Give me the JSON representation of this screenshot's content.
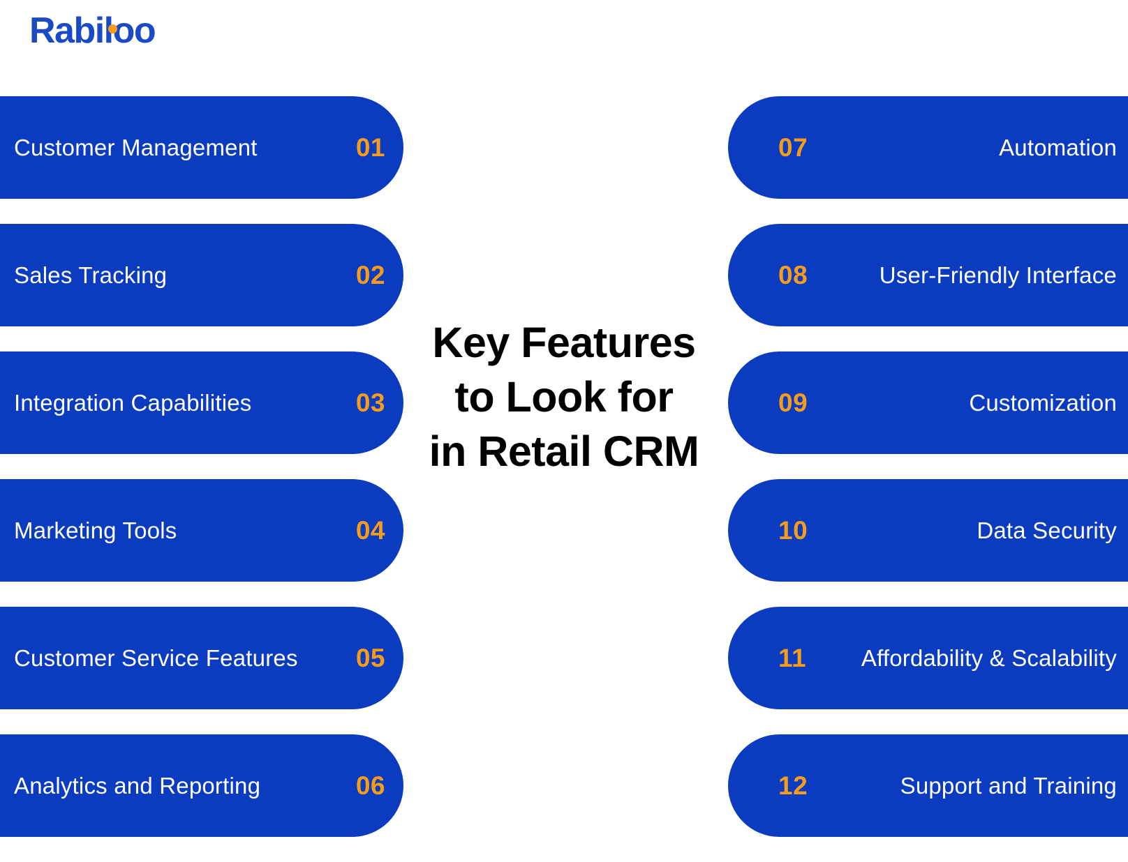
{
  "brand": {
    "name": "Rabiloo",
    "blue": "#1b4ac6",
    "orange": "#f59c1c"
  },
  "colors": {
    "pill_blue": "#0b3cc0",
    "number_orange": "#f59c1c",
    "label_white": "#ffffff",
    "title_black": "#000000",
    "background": "#ffffff"
  },
  "title": {
    "line1": "Key Features",
    "line2": "to Look for",
    "line3": "in Retail CRM",
    "full": "Key Features to Look for in Retail CRM"
  },
  "left_column": [
    {
      "number": "01",
      "label": "Customer Management"
    },
    {
      "number": "02",
      "label": "Sales Tracking"
    },
    {
      "number": "03",
      "label": "Integration Capabilities"
    },
    {
      "number": "04",
      "label": "Marketing Tools"
    },
    {
      "number": "05",
      "label": "Customer Service Features"
    },
    {
      "number": "06",
      "label": "Analytics and Reporting"
    }
  ],
  "right_column": [
    {
      "number": "07",
      "label": "Automation"
    },
    {
      "number": "08",
      "label": "User-Friendly Interface"
    },
    {
      "number": "09",
      "label": "Customization"
    },
    {
      "number": "10",
      "label": "Data Security"
    },
    {
      "number": "11",
      "label": "Affordability & Scalability"
    },
    {
      "number": "12",
      "label": "Support and Training"
    }
  ]
}
